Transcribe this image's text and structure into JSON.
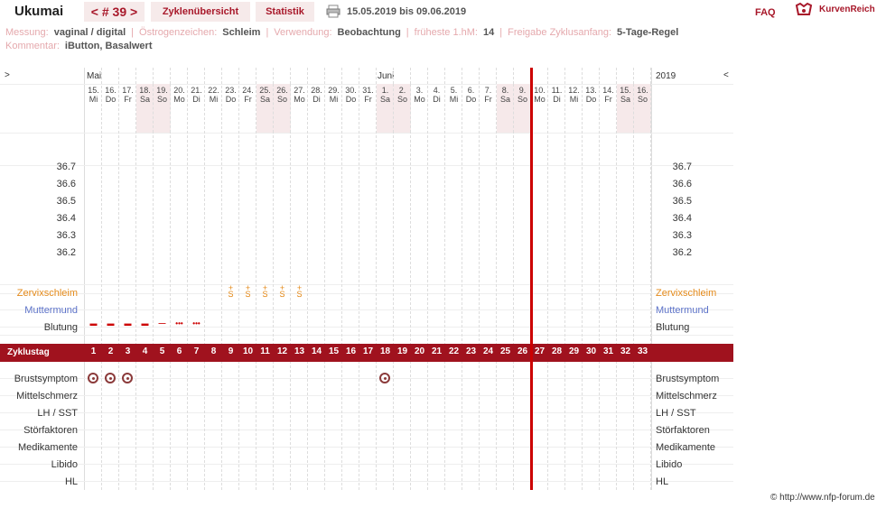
{
  "header": {
    "app_title": "Ukumai",
    "cycle_nav": "< # 39 >",
    "tabs": [
      "Zyklenübersicht",
      "Statistik"
    ],
    "date_range": "15.05.2019 bis 09.06.2019",
    "faq": "FAQ",
    "logo": "KurvenReich"
  },
  "meta": {
    "messung_k": "Messung:",
    "messung_v": "vaginal / digital",
    "oestrogen_k": "Östrogenzeichen:",
    "oestrogen_v": "Schleim",
    "verwendung_k": "Verwendung:",
    "verwendung_v": "Beobachtung",
    "hm_k": "früheste 1.hM:",
    "hm_v": "14",
    "freigabe_k": "Freigabe Zyklusanfang:",
    "freigabe_v": "5-Tage-Regel",
    "kommentar_k": "Kommentar:",
    "kommentar_v": "iButton, Basalwert"
  },
  "chart": {
    "left_arrow": ">",
    "right_arrow": "<",
    "months": [
      "Mai",
      "Juni"
    ],
    "year": "2019",
    "days": [
      {
        "d": "15.",
        "w": "Mi",
        "we": false
      },
      {
        "d": "16.",
        "w": "Do",
        "we": false
      },
      {
        "d": "17.",
        "w": "Fr",
        "we": false
      },
      {
        "d": "18.",
        "w": "Sa",
        "we": true
      },
      {
        "d": "19.",
        "w": "So",
        "we": true
      },
      {
        "d": "20.",
        "w": "Mo",
        "we": false
      },
      {
        "d": "21.",
        "w": "Di",
        "we": false
      },
      {
        "d": "22.",
        "w": "Mi",
        "we": false
      },
      {
        "d": "23.",
        "w": "Do",
        "we": false
      },
      {
        "d": "24.",
        "w": "Fr",
        "we": false
      },
      {
        "d": "25.",
        "w": "Sa",
        "we": true
      },
      {
        "d": "26.",
        "w": "So",
        "we": true
      },
      {
        "d": "27.",
        "w": "Mo",
        "we": false
      },
      {
        "d": "28.",
        "w": "Di",
        "we": false
      },
      {
        "d": "29.",
        "w": "Mi",
        "we": false
      },
      {
        "d": "30.",
        "w": "Do",
        "we": false
      },
      {
        "d": "31.",
        "w": "Fr",
        "we": false
      },
      {
        "d": "1.",
        "w": "Sa",
        "we": true
      },
      {
        "d": "2.",
        "w": "So",
        "we": true
      },
      {
        "d": "3.",
        "w": "Mo",
        "we": false
      },
      {
        "d": "4.",
        "w": "Di",
        "we": false
      },
      {
        "d": "5.",
        "w": "Mi",
        "we": false
      },
      {
        "d": "6.",
        "w": "Do",
        "we": false
      },
      {
        "d": "7.",
        "w": "Fr",
        "we": false
      },
      {
        "d": "8.",
        "w": "Sa",
        "we": true
      },
      {
        "d": "9.",
        "w": "So",
        "we": true
      },
      {
        "d": "10.",
        "w": "Mo",
        "we": false
      },
      {
        "d": "11.",
        "w": "Di",
        "we": false
      },
      {
        "d": "12.",
        "w": "Mi",
        "we": false
      },
      {
        "d": "13.",
        "w": "Do",
        "we": false
      },
      {
        "d": "14.",
        "w": "Fr",
        "we": false
      },
      {
        "d": "15.",
        "w": "Sa",
        "we": true
      },
      {
        "d": "16.",
        "w": "So",
        "we": true
      }
    ],
    "temps": [
      "36.7",
      "36.6",
      "36.5",
      "36.4",
      "36.3",
      "36.2"
    ],
    "rows_top": [
      "Zervixschleim",
      "Muttermund",
      "Blutung"
    ],
    "cycle_label": "Zyklustag",
    "rows_bottom": [
      "Brustsymptom",
      "Mittelschmerz",
      "LH / SST",
      "Störfaktoren",
      "Medikamente",
      "Libido",
      "HL"
    ],
    "schleim_days": [
      9,
      10,
      11,
      12,
      13
    ],
    "schleim_symbol": "S",
    "bleeding": [
      {
        "day": 1,
        "sym": "▬"
      },
      {
        "day": 2,
        "sym": "▬"
      },
      {
        "day": 3,
        "sym": "▬"
      },
      {
        "day": 4,
        "sym": "▬"
      },
      {
        "day": 5,
        "sym": "—"
      },
      {
        "day": 6,
        "sym": "•••"
      },
      {
        "day": 7,
        "sym": "•••"
      }
    ],
    "breast_days": [
      1,
      2,
      3,
      18
    ],
    "today_day": 26
  },
  "copyright": "© http://www.nfp-forum.de"
}
